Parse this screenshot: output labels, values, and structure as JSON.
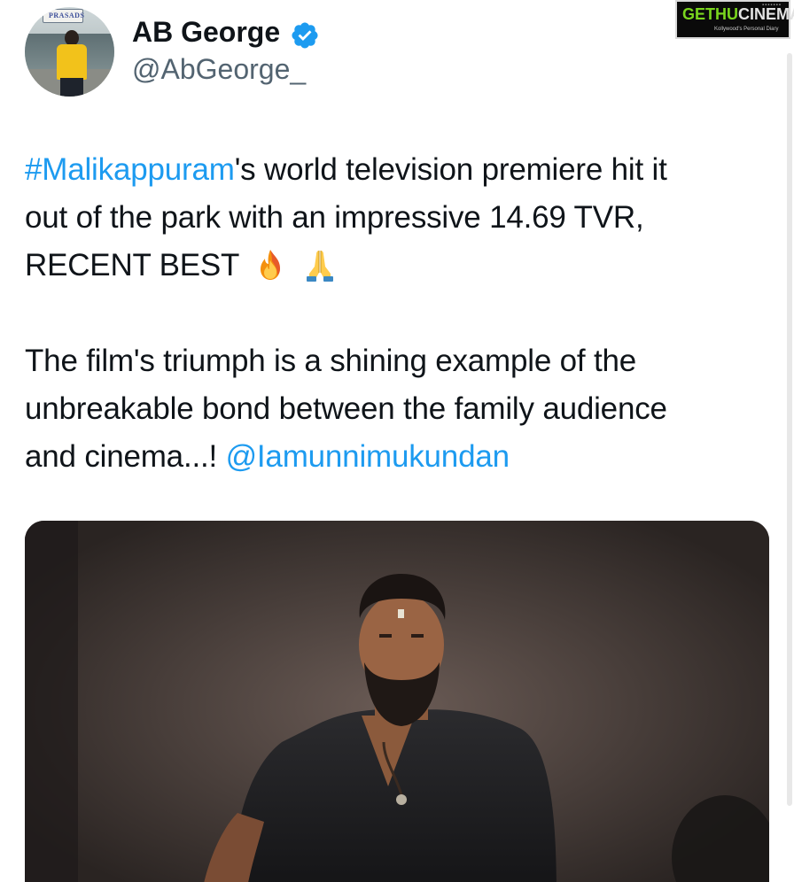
{
  "author": {
    "name": "AB George",
    "handle": "@AbGeorge_",
    "avatar_sign": "PRASADS"
  },
  "watermark": {
    "brand_part1": "GETHU",
    "brand_part2": "CINEMA",
    "tagline": "Kollywood's Personal Diary"
  },
  "tweet": {
    "hashtag": "#Malikappuram",
    "line1_rest": "'s world television premiere hit it",
    "line2": "out of the park with an impressive 14.69 TVR,",
    "line3": "RECENT BEST",
    "line4": "The film's triumph is a shining example of the",
    "line5": "unbreakable bond between the family audience",
    "line6_prefix": "and cinema...! ",
    "mention": "@Iamunnimukundan"
  },
  "colors": {
    "link": "#1d9bf0",
    "text": "#0f1419",
    "muted": "#536471",
    "verified": "#1d9bf0"
  },
  "icons": {
    "verified": "verified-badge-icon",
    "emoji1": "fire-emoji-icon",
    "emoji2": "folded-hands-emoji-icon"
  }
}
